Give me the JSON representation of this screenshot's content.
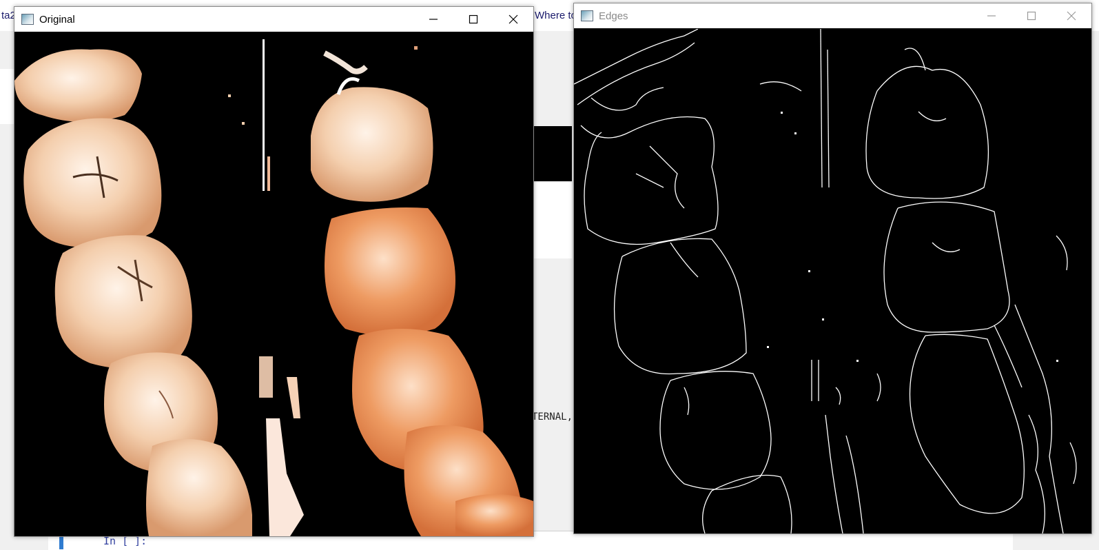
{
  "background": {
    "tab_fragment_left": "ta2",
    "tab_fragment_right": "Where to",
    "code_fragment": "TERNAL,",
    "cell_prompt": "In [ ]:"
  },
  "windows": {
    "original": {
      "title": "Original",
      "active": true
    },
    "edges": {
      "title": "Edges",
      "active": false
    }
  },
  "icons": [
    "app-icon",
    "minimize-icon",
    "maximize-icon",
    "close-icon"
  ],
  "colors": {
    "title_active": "#000000",
    "title_inactive": "#8a8a8a",
    "canvas": "#000000",
    "tooth_light": "#f6d2b6",
    "tooth_orange": "#e98a52"
  }
}
